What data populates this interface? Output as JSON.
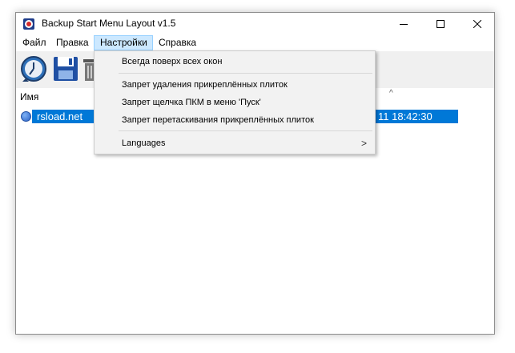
{
  "window": {
    "title": "Backup Start Menu Layout v1.5"
  },
  "menu": [
    {
      "label": "Файл"
    },
    {
      "label": "Правка"
    },
    {
      "label": "Настройки"
    },
    {
      "label": "Справка"
    }
  ],
  "dropdown": {
    "items": [
      {
        "label": "Всегда поверх всех окон"
      },
      {
        "label": "Запрет удаления прикреплённых плиток"
      },
      {
        "label": "Запрет щелчка ПКМ в меню 'Пуск'"
      },
      {
        "label": "Запрет перетаскивания прикреплённых плиток"
      },
      {
        "label": "Languages",
        "submenu_arrow": ">"
      }
    ]
  },
  "list": {
    "column_name": "Имя",
    "sort_indicator": "^",
    "rows": [
      {
        "name": "rsload.net",
        "date": "11 18:42:30"
      }
    ]
  },
  "colors": {
    "selection": "#0078d7",
    "menu_highlight": "#cce8ff",
    "toolbar_bg": "#f0f0f0"
  }
}
